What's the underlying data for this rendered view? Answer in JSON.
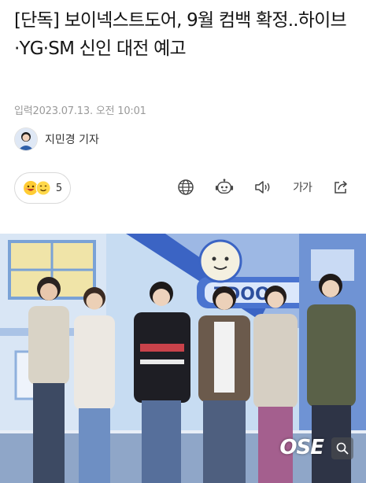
{
  "article": {
    "title": "[단독] 보이넥스트도어, 9월 컴백 확정..하이브·YG·SM 신인 대전 예고",
    "date": "입력2023.07.13. 오전 10:01"
  },
  "reporter": {
    "name": "지민경 기자"
  },
  "reactions": {
    "count": "5",
    "icons": [
      "grinning-face-icon",
      "smiling-face-icon"
    ]
  },
  "toolbar": {
    "icons": [
      "globe-icon",
      "robot-icon",
      "speaker-icon",
      "font-size-icon",
      "share-icon"
    ],
    "font_size_label": "가가"
  },
  "photo": {
    "sign_text": "TDOOR",
    "watermark": "OSE"
  },
  "colors": {
    "sky": "#bcd4ef",
    "blue_stage": "#3b64c4",
    "text_gray": "#9a9a9a"
  }
}
